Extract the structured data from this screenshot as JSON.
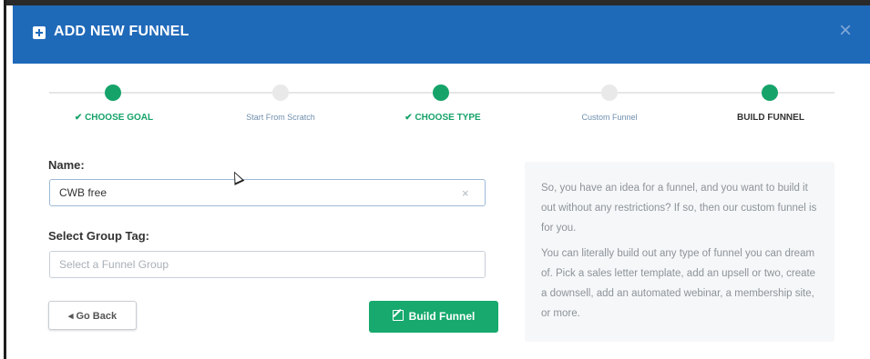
{
  "modal": {
    "title": "ADD NEW FUNNEL",
    "close_symbol": "×"
  },
  "steps": [
    {
      "label": "✔ CHOOSE GOAL",
      "state": "done"
    },
    {
      "label": "Start From Scratch",
      "state": "inactive"
    },
    {
      "label": "✔ CHOOSE TYPE",
      "state": "done"
    },
    {
      "label": "Custom Funnel",
      "state": "inactive"
    },
    {
      "label": "BUILD FUNNEL",
      "state": "current"
    }
  ],
  "form": {
    "name_label": "Name:",
    "name_value": "CWB free",
    "clear_symbol": "×",
    "group_label": "Select Group Tag:",
    "group_placeholder": "Select a Funnel Group"
  },
  "buttons": {
    "back_label": "◂ Go Back",
    "build_label": "Build Funnel"
  },
  "info": {
    "paragraph1": "So, you have an idea for a funnel, and you want to build it out without any restrictions? If so, then our custom funnel is for you.",
    "paragraph2": "You can literally build out any type of funnel you can dream of. Pick a sales letter template, add an upsell or two, create a downsell, add an automated webinar, a membership site, or more."
  },
  "colors": {
    "header": "#1f69b9",
    "accent_green": "#16a36a"
  }
}
